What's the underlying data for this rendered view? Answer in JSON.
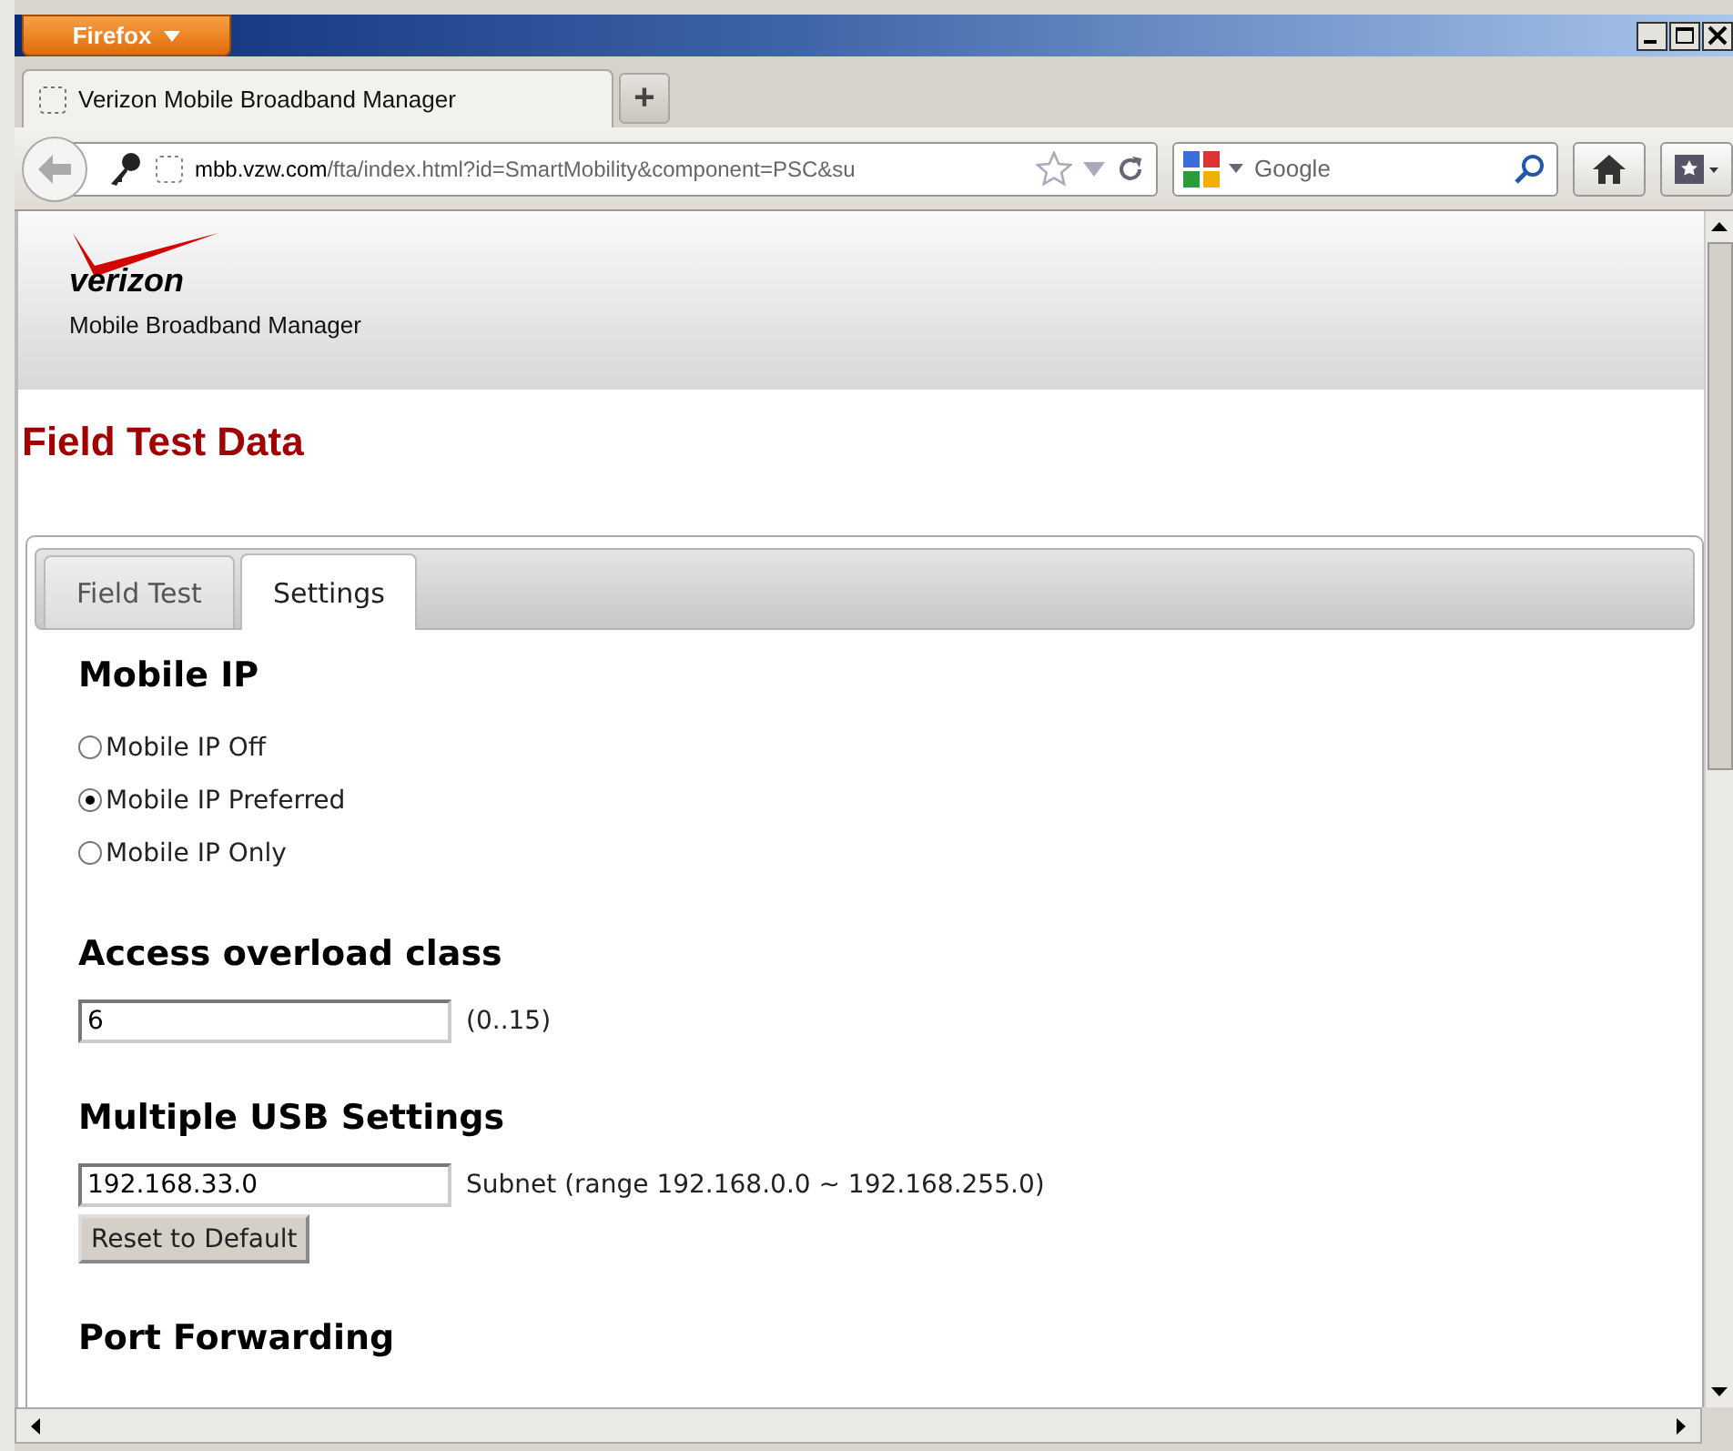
{
  "window": {
    "menu_button": "Firefox"
  },
  "browser_tabs": [
    {
      "title": "Verizon Mobile Broadband Manager",
      "selected": true
    }
  ],
  "new_tab_button": "+",
  "navigation": {
    "url_domain": "mbb.vzw.com",
    "url_path": "/fta/index.html?id=SmartMobility&component=PSC&su",
    "search_placeholder": "Google"
  },
  "page": {
    "logo": "verizon",
    "subtitle": "Mobile Broadband Manager",
    "title": "Field Test Data",
    "tabs": [
      {
        "label": "Field Test",
        "selected": false
      },
      {
        "label": "Settings",
        "selected": true
      }
    ],
    "sections": [
      {
        "kind": "radios",
        "heading": "Mobile IP",
        "options": [
          {
            "label": "Mobile IP Off",
            "selected": false
          },
          {
            "label": "Mobile IP Preferred",
            "selected": true
          },
          {
            "label": "Mobile IP Only",
            "selected": false
          }
        ]
      },
      {
        "kind": "field",
        "heading": "Access overload class",
        "value": "6",
        "hint": "(0..15)"
      },
      {
        "kind": "field",
        "heading": "Multiple USB Settings",
        "value": "192.168.33.0",
        "hint": "Subnet (range 192.168.0.0 ~ 192.168.255.0)",
        "button": "Reset to Default"
      },
      {
        "kind": "heading",
        "heading": "Port Forwarding"
      }
    ]
  }
}
